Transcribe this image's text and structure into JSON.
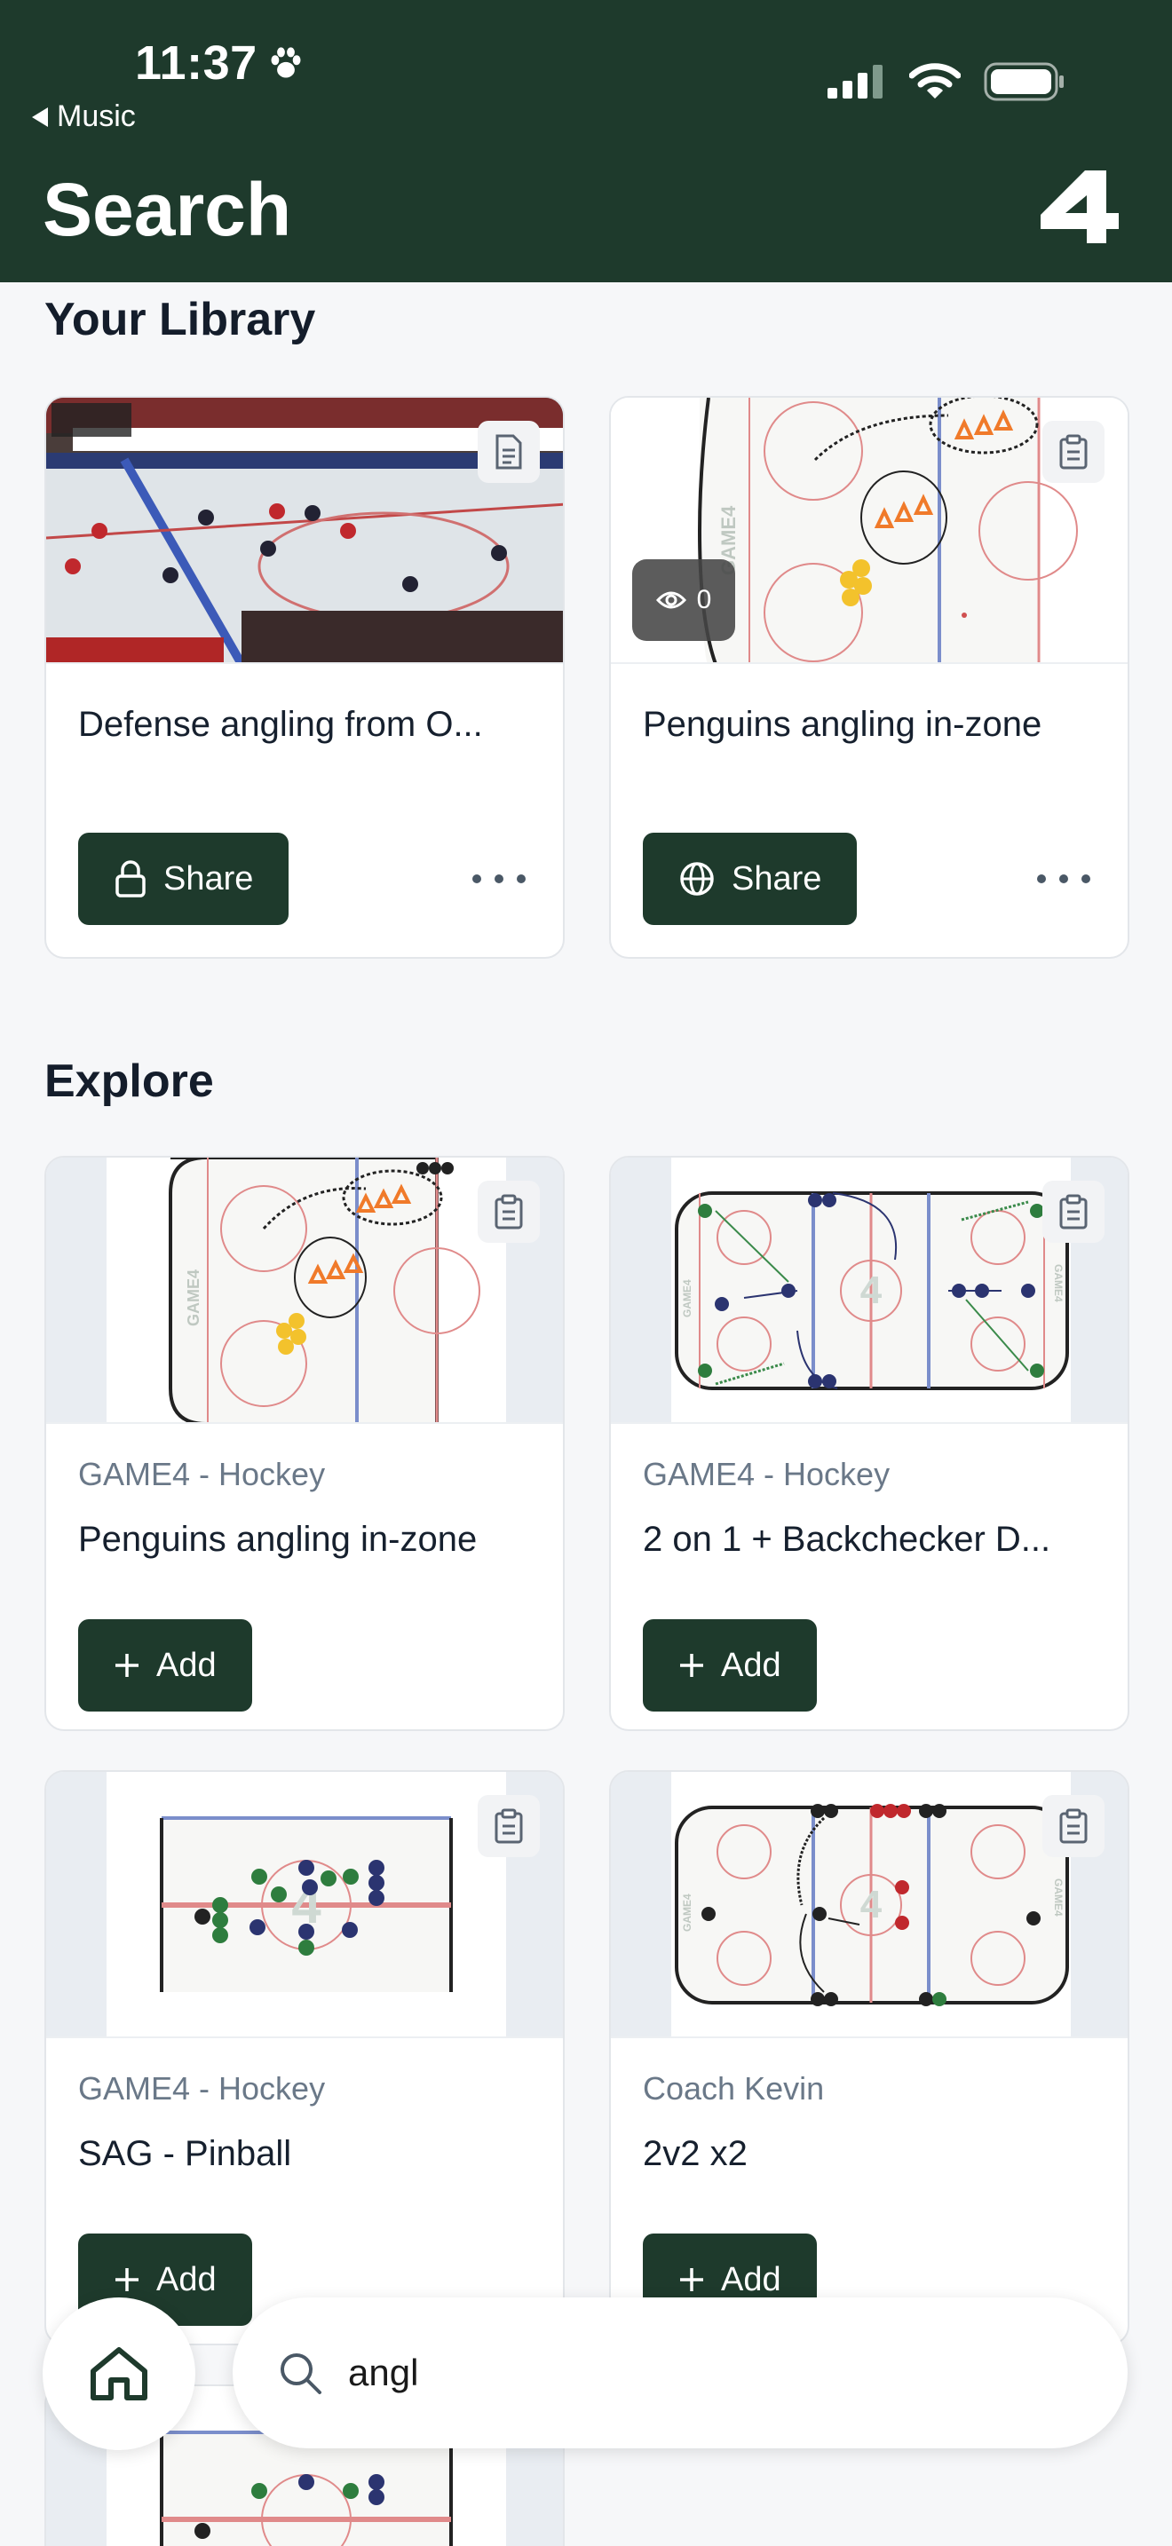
{
  "status_bar": {
    "time": "11:37",
    "back_app": "Music"
  },
  "header": {
    "title": "Search",
    "logo": "4"
  },
  "library": {
    "section_title": "Your Library",
    "cards": [
      {
        "title": "Defense angling from O...",
        "share_label": "Share",
        "share_icon": "lock-icon",
        "badge_icon": "document-icon"
      },
      {
        "title": "Penguins angling in-zone",
        "share_label": "Share",
        "share_icon": "globe-icon",
        "views": "0",
        "badge_icon": "clipboard-icon"
      }
    ]
  },
  "explore": {
    "section_title": "Explore",
    "cards": [
      {
        "author": "GAME4 - Hockey",
        "title": "Penguins angling in-zone",
        "add_label": "Add"
      },
      {
        "author": "GAME4 - Hockey",
        "title": "2 on 1 + Backchecker D...",
        "add_label": "Add"
      },
      {
        "author": "GAME4 - Hockey",
        "title": "SAG - Pinball",
        "add_label": "Add"
      },
      {
        "author": "Coach Kevin",
        "title": "2v2 x2",
        "add_label": "Add"
      }
    ]
  },
  "search": {
    "value": "angl"
  },
  "colors": {
    "brand": "#1e3a2c",
    "background": "#f6f7f9",
    "rink_red": "#e08a8a",
    "rink_blue": "#7b8ecb",
    "cone": "#f07a2a",
    "puck_gold": "#f3c22c"
  }
}
